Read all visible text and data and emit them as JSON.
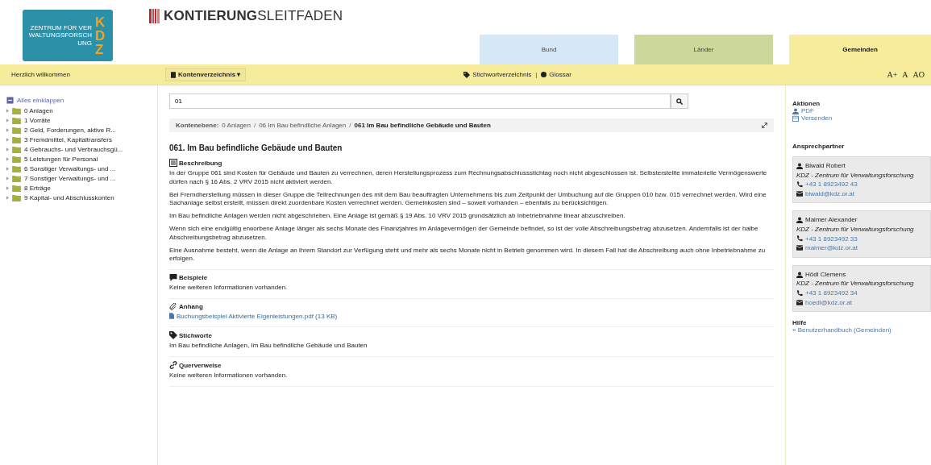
{
  "logo": {
    "letters": "KDZ",
    "caption": "ZENTRUM FÜR VERWALTUNGSFORSCHUNG"
  },
  "brand": "**KONTIERUNG**SLEITFADEN",
  "tabs": [
    {
      "label": "Bund",
      "color": "#d5e8f6",
      "selected": false
    },
    {
      "label": "Länder",
      "color": "#cad899",
      "selected": false
    },
    {
      "label": "Gemeinden",
      "color": "#f6ec9c",
      "selected": true
    }
  ],
  "toolbar": {
    "welcome": "Herzlich willkommen",
    "menu": "Kontenverzeichnis ▾",
    "links": [
      {
        "kind": "tag",
        "label": "Stichwortverzeichnis"
      },
      {
        "kind": "dot",
        "label": "Glossar"
      }
    ],
    "separator": "|",
    "font_buttons": [
      "A+",
      "A",
      "AO"
    ]
  },
  "sidebar": {
    "collapse": "Alles einklappen",
    "items": [
      {
        "label": "0 Anlagen"
      },
      {
        "label": "1 Vorräte"
      },
      {
        "label": "2 Geld, Forderungen, aktive R..."
      },
      {
        "label": "3 Fremdmittel, Kapitaltransfers"
      },
      {
        "label": "4 Gebrauchs- und Verbrauchsgü..."
      },
      {
        "label": "5 Leistungen für Personal"
      },
      {
        "label": "6 Sonstiger Verwaltungs- und ..."
      },
      {
        "label": "7 Sonstiger Verwaltungs- und ..."
      },
      {
        "label": "8 Erträge"
      },
      {
        "label": "9 Kapital- und Abschlusskonten"
      }
    ]
  },
  "search": {
    "value": "01"
  },
  "breadcrumb": {
    "label": "Kontenebene:",
    "separator": "/",
    "items": [
      {
        "label": "0 Anlagen",
        "current": false
      },
      {
        "label": "06 Im Bau befindliche Anlagen",
        "current": false
      },
      {
        "label": "061 Im Bau befindliche Gebäude und Bauten",
        "current": true
      }
    ]
  },
  "heading": "061. Im Bau befindliche Gebäude und Bauten",
  "sections": [
    {
      "kind": "description",
      "title": "Beschreibung",
      "paragraphs": [
        "In der Gruppe 061 sind Kosten für Gebäude und Bauten zu verrechnen, deren Herstellungsprozess zum Rechnungsabschlussstichtag noch nicht abgeschlossen ist. Selbsterstellte immaterielle Vermögenswerte dürfen nach § 16 Abs. 2 VRV 2015 nicht aktiviert werden.",
        "Bei Fremdherstellung müssen in dieser Gruppe die Teilrechnungen des mit dem Bau beauftragten Unternehmens bis zum Zeitpunkt der Umbuchung auf die Gruppen 010 bzw. 015 verrechnet werden. Wird eine Sachanlage selbst erstellt, müssen direkt zuordenbare Kosten verrechnet werden. Gemeinkosten sind – soweit vorhanden – ebenfalls zu berücksichtigen.",
        "Im Bau befindliche Anlagen werden nicht abgeschrieben. Eine Anlage ist gemäß § 19 Abs. 10 VRV 2015 grundsätzlich ab Inbetriebnahme linear abzuschreiben.",
        "Wenn sich eine endgültig erworbene Anlage länger als sechs Monate des Finanzjahres im Anlagevermögen der Gemeinde befindet, so ist der volle Abschreibungsbetrag abzusetzen. Andernfalls ist der halbe Abschreibungsbetrag abzusetzen.",
        "Eine Ausnahme besteht, wenn die Anlage an ihrem Standort zur Verfügung steht und mehr als sechs Monate nicht in Betrieb genommen wird. In diesem Fall hat die Abschreibung auch ohne Inbetriebnahme zu erfolgen."
      ]
    },
    {
      "kind": "examples",
      "title": "Beispiele",
      "paragraphs": [
        "Keine weiteren Informationen vorhanden."
      ]
    },
    {
      "kind": "attachment",
      "title": "Anhang",
      "files": [
        "Buchungsbeispiel Aktivierte Eigenleistungen.pdf (13 KB)"
      ]
    },
    {
      "kind": "keywords",
      "title": "Stichworte",
      "paragraphs": [
        "Im Bau befindliche Anlagen, Im Bau befindliche Gebäude und Bauten"
      ]
    },
    {
      "kind": "crossref",
      "title": "Querverweise",
      "paragraphs": [
        "Keine weiteren Informationen vorhanden."
      ]
    }
  ],
  "aside": {
    "actions_title": "Aktionen",
    "actions": [
      {
        "kind": "pdf",
        "label": "PDF"
      },
      {
        "kind": "send",
        "label": "Versenden"
      }
    ],
    "contacts_title": "Ansprechpartner",
    "contacts": [
      {
        "name": "Biwald Robert",
        "org": "KDZ - Zentrum für Verwaltungsforschung",
        "phone": "+43 1 8923492 43",
        "email": "biwald@kdz.or.at"
      },
      {
        "name": "Maimer Alexander",
        "org": "KDZ - Zentrum für Verwaltungsforschung",
        "phone": "+43 1 8923492 33",
        "email": "maimer@kdz.or.at"
      },
      {
        "name": "Hödl Clemens",
        "org": "KDZ - Zentrum für Verwaltungsforschung",
        "phone": "+43 1 8923492 34",
        "email": "hoedl@kdz.or.at"
      }
    ],
    "help_title": "Hilfe",
    "help_link": "» Benutzerhandbuch (Gemeinden)"
  }
}
